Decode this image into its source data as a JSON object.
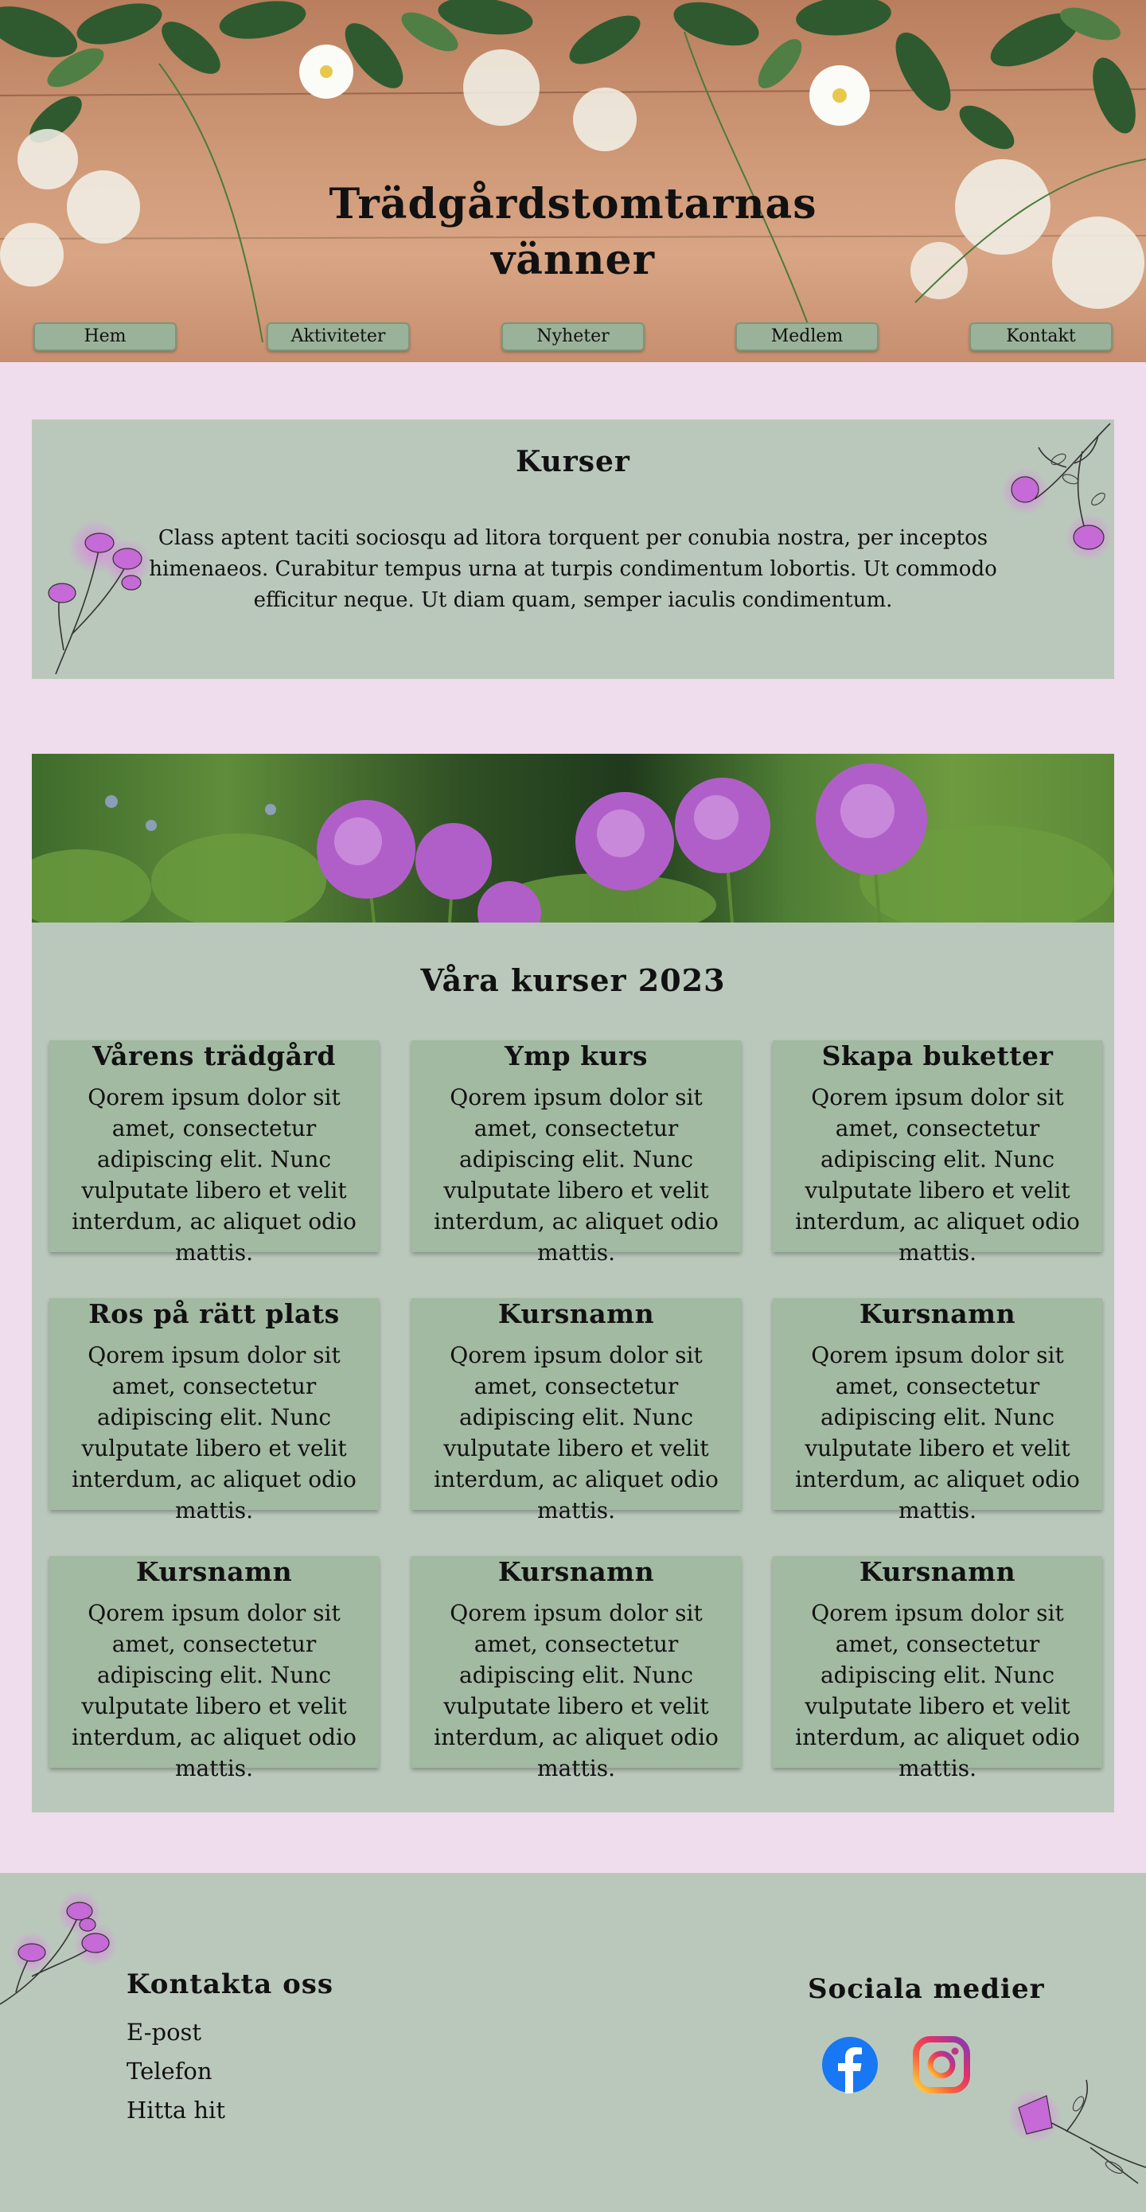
{
  "header": {
    "title_line1": "Trädgårdstomtarnas",
    "title_line2": "vänner"
  },
  "nav": [
    {
      "label": "Hem"
    },
    {
      "label": "Aktiviteter"
    },
    {
      "label": "Nyheter"
    },
    {
      "label": "Medlem"
    },
    {
      "label": "Kontakt"
    }
  ],
  "intro": {
    "title": "Kurser",
    "text": "Class aptent taciti sociosqu ad litora torquent per conubia nostra, per inceptos himenaeos. Curabitur tempus urna at turpis condimentum lobortis. Ut commodo efficitur neque. Ut diam quam, semper iaculis condimentum."
  },
  "courses": {
    "title": "Våra kurser 2023",
    "items": [
      {
        "title": "Vårens trädgård",
        "text": "Qorem ipsum dolor sit amet, consectetur adipiscing elit. Nunc vulputate libero et velit interdum, ac aliquet odio mattis."
      },
      {
        "title": "Ymp kurs",
        "text": "Qorem ipsum dolor sit amet, consectetur adipiscing elit. Nunc vulputate libero et velit interdum, ac aliquet odio mattis."
      },
      {
        "title": "Skapa buketter",
        "text": "Qorem ipsum dolor sit amet, consectetur adipiscing elit. Nunc vulputate libero et velit interdum, ac aliquet odio mattis."
      },
      {
        "title": "Ros på rätt plats",
        "text": "Qorem ipsum dolor sit amet, consectetur adipiscing elit. Nunc vulputate libero et velit interdum, ac aliquet odio mattis."
      },
      {
        "title": "Kursnamn",
        "text": "Qorem ipsum dolor sit amet, consectetur adipiscing elit. Nunc vulputate libero et velit interdum, ac aliquet odio mattis."
      },
      {
        "title": "Kursnamn",
        "text": "Qorem ipsum dolor sit amet, consectetur adipiscing elit. Nunc vulputate libero et velit interdum, ac aliquet odio mattis."
      },
      {
        "title": "Kursnamn",
        "text": "Qorem ipsum dolor sit amet, consectetur adipiscing elit. Nunc vulputate libero et velit interdum, ac aliquet odio mattis."
      },
      {
        "title": "Kursnamn",
        "text": "Qorem ipsum dolor sit amet, consectetur adipiscing elit. Nunc vulputate libero et velit interdum, ac aliquet odio mattis."
      },
      {
        "title": "Kursnamn",
        "text": "Qorem ipsum dolor sit amet, consectetur adipiscing elit. Nunc vulputate libero et velit interdum, ac aliquet odio mattis."
      }
    ]
  },
  "footer": {
    "contact_title": "Kontakta oss",
    "contact_links": [
      "E-post",
      "Telefon",
      "Hitta hit"
    ],
    "social_title": "Sociala medier",
    "social_icons": [
      "facebook-icon",
      "instagram-icon"
    ]
  },
  "colors": {
    "page_bg": "#efdcec",
    "panel_bg": "#bac8bb",
    "card_bg": "#a2b9a2",
    "nav_button_bg": "#9bb29a",
    "flower_accent": "#c06fd0",
    "facebook_blue": "#1877f2"
  }
}
